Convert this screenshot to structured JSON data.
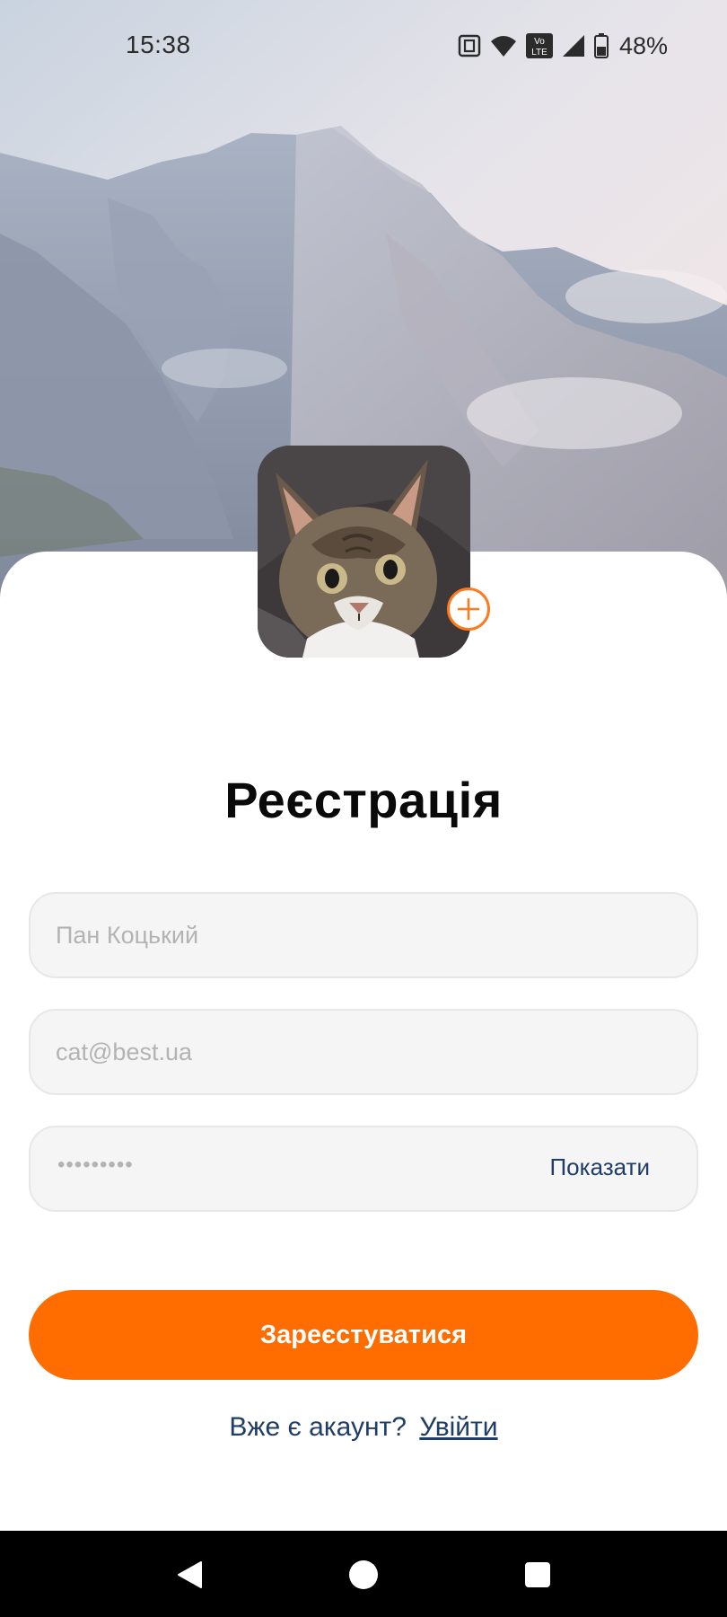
{
  "status_bar": {
    "time": "15:38",
    "battery_percent": "48%",
    "icons": [
      "nfc-icon",
      "wifi-icon",
      "volte-icon",
      "signal-icon",
      "battery-icon"
    ],
    "volte_line1": "Vo",
    "volte_line2": "LTE",
    "battery_level": 0.48
  },
  "header": {
    "background": "mountain-photo"
  },
  "avatar": {
    "image": "cat-photo",
    "add_icon": "plus-circle-icon"
  },
  "form": {
    "title": "Реєстрація",
    "name_placeholder": "Пан Коцький",
    "email_placeholder": "cat@best.ua",
    "password_value": "•••••••••",
    "show_password_label": "Показати",
    "submit_label": "Зареєстуватися"
  },
  "login": {
    "prompt": "Вже є акаунт?",
    "link_label": "Увійти"
  },
  "nav_bar": {
    "buttons": [
      "back-icon",
      "home-icon",
      "recents-icon"
    ]
  },
  "colors": {
    "accent": "#ff6c00",
    "link": "#1f3d66",
    "field_bg": "#f5f5f5"
  }
}
